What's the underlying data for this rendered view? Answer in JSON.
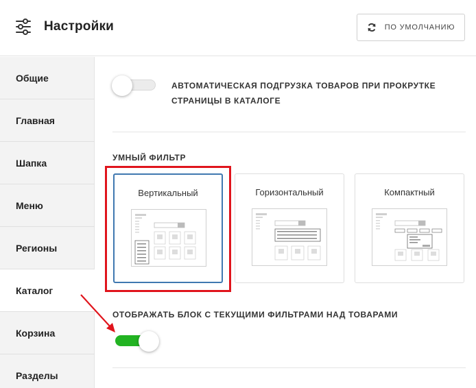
{
  "header": {
    "title": "Настройки",
    "reset_label": "ПО УМОЛЧАНИЮ"
  },
  "sidebar": {
    "items": [
      {
        "label": "Общие",
        "active": false
      },
      {
        "label": "Главная",
        "active": false
      },
      {
        "label": "Шапка",
        "active": false
      },
      {
        "label": "Меню",
        "active": false
      },
      {
        "label": "Регионы",
        "active": false
      },
      {
        "label": "Каталог",
        "active": true
      },
      {
        "label": "Корзина",
        "active": false
      },
      {
        "label": "Разделы",
        "active": false
      }
    ]
  },
  "main": {
    "autoload": {
      "label_line1": "АВТОМАТИЧЕСКАЯ ПОДГРУЗКА ТОВАРОВ ПРИ ПРОКРУТКЕ",
      "label_line2": "СТРАНИЦЫ В КАТАЛОГЕ",
      "enabled": false
    },
    "smart_filter": {
      "title": "УМНЫЙ ФИЛЬТР",
      "options": [
        {
          "label": "Вертикальный",
          "selected": true
        },
        {
          "label": "Горизонтальный",
          "selected": false
        },
        {
          "label": "Компактный",
          "selected": false
        }
      ]
    },
    "current_filters": {
      "label": "ОТОБРАЖАТЬ БЛОК С ТЕКУЩИМИ ФИЛЬТРАМИ НАД ТОВАРАМИ",
      "enabled": true
    }
  },
  "colors": {
    "toggle_on": "#22b322",
    "selected_card_border": "#3f78b0",
    "annotation_red": "#e0141c"
  }
}
